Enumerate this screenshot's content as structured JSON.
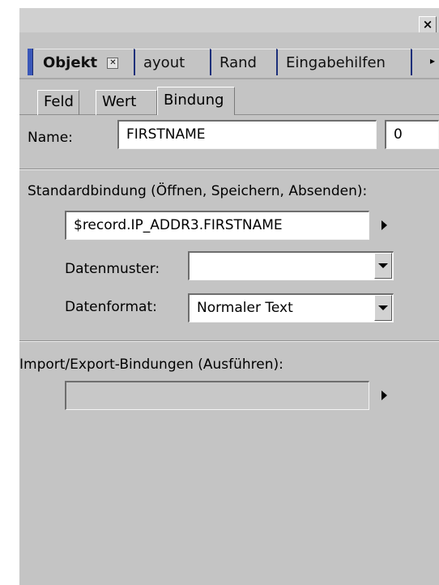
{
  "window": {
    "close_glyph": "×"
  },
  "tabs": {
    "main": [
      {
        "label": "Objekt"
      },
      {
        "label": "ayout"
      },
      {
        "label": "Rand"
      },
      {
        "label": "Eingabehilfen"
      }
    ],
    "sub": [
      {
        "label": "Feld"
      },
      {
        "label": "Wert"
      },
      {
        "label": "Bindung"
      }
    ]
  },
  "name_field": {
    "label": "Name:",
    "value": "FIRSTNAME",
    "index_value": "0"
  },
  "standard_binding": {
    "heading": "Standardbindung (Öffnen, Speichern, Absenden):",
    "value": "$record.IP_ADDR3.FIRSTNAME",
    "pattern_label": "Datenmuster:",
    "pattern_value": "",
    "format_label": "Datenformat:",
    "format_value": "Normaler Text"
  },
  "import_export": {
    "heading": "Import/Export-Bindungen (Ausführen):",
    "value": ""
  },
  "colors": {
    "panel_bg": "#c4c4c4",
    "tab_accent": "#1c2f7a",
    "gripper": "#3a57b8"
  }
}
